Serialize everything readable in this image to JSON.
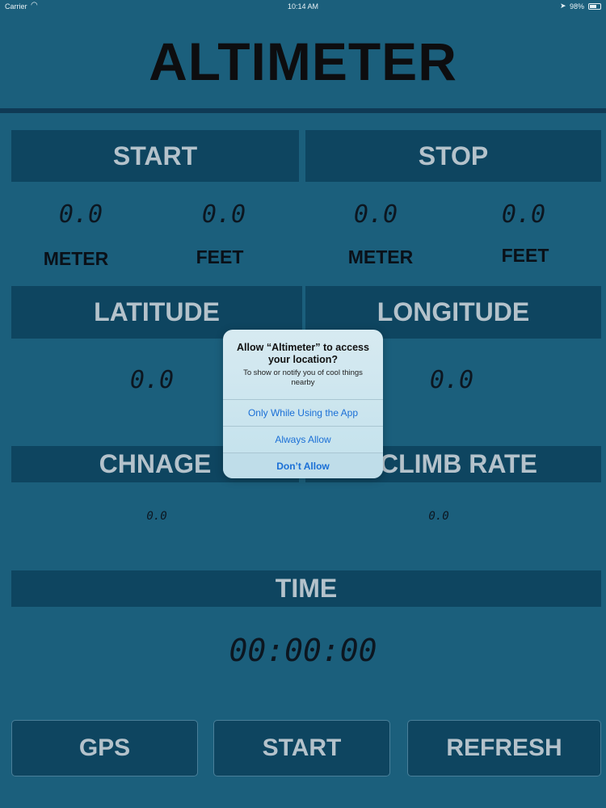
{
  "status_bar": {
    "carrier": "Carrier",
    "wifi_icon": "wifi-icon",
    "time": "10:14 AM",
    "location_icon": "location-arrow-icon",
    "battery_text": "98%",
    "battery_icon": "battery-icon"
  },
  "app": {
    "title": "ALTIMETER"
  },
  "start_panel": {
    "header": "START",
    "meter_value": "0.0",
    "meter_unit": "METER",
    "feet_value": "0.0",
    "feet_unit": "FEET"
  },
  "stop_panel": {
    "header": "STOP",
    "meter_value": "0.0",
    "meter_unit": "METER",
    "feet_value": "0.0",
    "feet_unit": "FEET"
  },
  "latitude_panel": {
    "header": "LATITUDE",
    "value": "0.0"
  },
  "longitude_panel": {
    "header": "LONGITUDE",
    "value": "0.0"
  },
  "change_panel": {
    "header": "CHNAGE",
    "value": "0.0"
  },
  "climb_panel": {
    "header": "CLIMB RATE",
    "value": "0.0"
  },
  "time_panel": {
    "header": "TIME",
    "value": "00:00:00"
  },
  "bottom_buttons": {
    "gps": "GPS",
    "start": "START",
    "refresh": "REFRESH"
  },
  "alert": {
    "title": "Allow “Altimeter” to access your location?",
    "message": "To show or notify you of cool things nearby",
    "actions": [
      "Only While Using the App",
      "Always Allow",
      "Don’t Allow"
    ]
  },
  "colors": {
    "background": "#1b5f7c",
    "panel": "#0e4560",
    "panel_text": "#b4c2cb",
    "alert_link": "#1a6fd6"
  }
}
